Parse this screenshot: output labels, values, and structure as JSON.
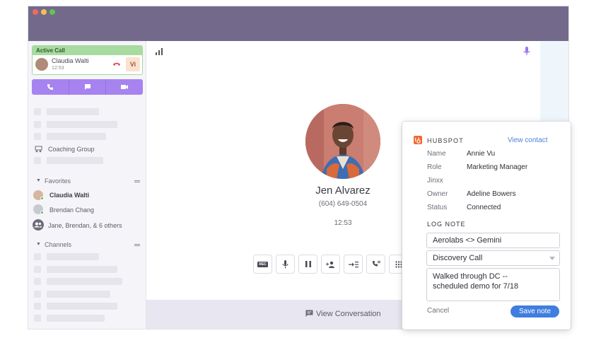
{
  "sidebar": {
    "active_call": {
      "header": "Active Call",
      "caller_name": "Claudia Walti",
      "duration": "12:53",
      "badge": "Vi"
    },
    "coaching_group": "Coaching Group",
    "favorites": {
      "heading": "Favorites",
      "items": [
        {
          "label": "Claudia Walti"
        },
        {
          "label": "Brendan Chang"
        },
        {
          "label": "Jane, Brendan, & 6 others"
        }
      ]
    },
    "channels": {
      "heading": "Channels"
    }
  },
  "call": {
    "caller_name": "Jen Alvarez",
    "phone": "(604) 649-0504",
    "timer": "12:53",
    "rec_label": "REC",
    "view_conversation": "View Conversation"
  },
  "hubspot": {
    "brand": "HUBSPOT",
    "view_contact": "View contact",
    "fields": [
      {
        "label": "Name",
        "value": "Annie Vu"
      },
      {
        "label": "Role",
        "value": "Marketing Manager"
      },
      {
        "label": "Jinxx",
        "value": ""
      },
      {
        "label": "Owner",
        "value": "Adeline Bowers"
      },
      {
        "label": "Status",
        "value": "Connected"
      }
    ],
    "log_note": {
      "heading": "LOG NOTE",
      "subject": "Aerolabs <> Gemini",
      "call_type": "Discovery Call",
      "note": "Walked through DC --\nscheduled demo for 7/18",
      "cancel": "Cancel",
      "save": "Save note"
    }
  },
  "colors": {
    "titlebar": "#736a8b",
    "accent_purple": "#a783f0",
    "active_green": "#a8dba0",
    "hubspot_orange": "#f06a35",
    "link_blue": "#4d7fd6",
    "save_blue": "#3f7ee0"
  }
}
